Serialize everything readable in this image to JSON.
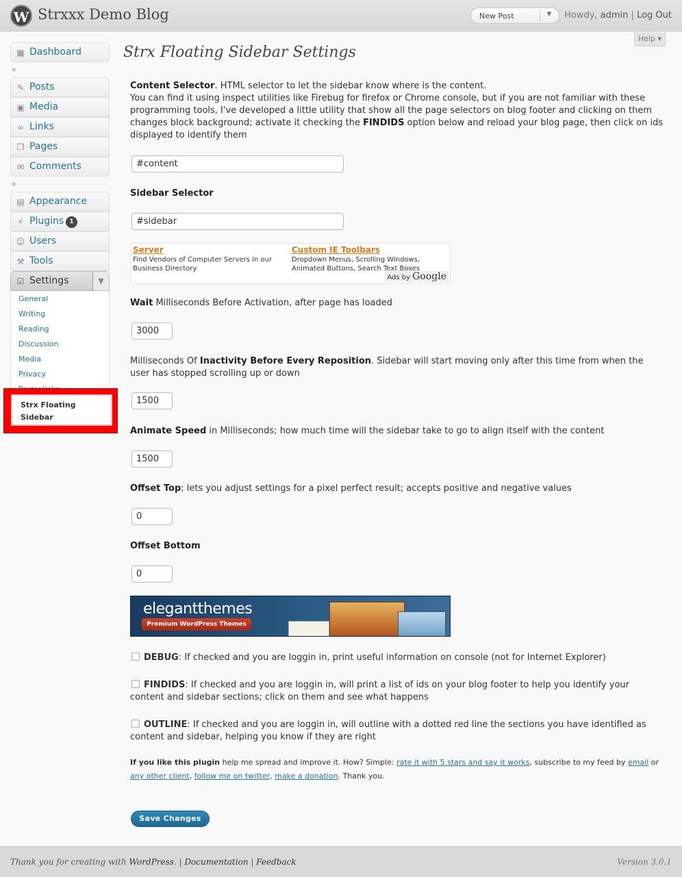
{
  "header": {
    "logo": "W",
    "site_title": "Strxxx Demo Blog",
    "favorite_action": "New Post",
    "howdy": "Howdy,",
    "user": "admin",
    "separator": "|",
    "logout": "Log Out",
    "help": "Help ▾"
  },
  "menu": {
    "dashboard": "Dashboard",
    "posts": "Posts",
    "media": "Media",
    "links": "Links",
    "pages": "Pages",
    "comments": "Comments",
    "appearance": "Appearance",
    "plugins": "Plugins",
    "plugins_badge": "1",
    "users": "Users",
    "tools": "Tools",
    "settings": "Settings",
    "settings_sub": [
      "General",
      "Writing",
      "Reading",
      "Discussion",
      "Media",
      "Privacy",
      "Permalinks"
    ],
    "current_sub_line1": "Strx Floating",
    "current_sub_line2": "Sidebar"
  },
  "page": {
    "title": "Strx Floating Sidebar Settings",
    "content_selector_label": "Content Selector",
    "content_selector_desc_1": ". HTML selector to let the sidebar know where is the content.",
    "content_selector_desc_2": "You can find it using inspect utilities like Firebug for firefox or Chrome console, but if you are not familiar with these programming tools, I've developed a little utility that show all the page selectors on blog footer and clicking on them changes block background; activate it checking the ",
    "findids_word": "FINDIDS",
    "content_selector_desc_3": " option below and reload your blog page, then click on ids displayed to identify them",
    "content_selector_value": "#content",
    "sidebar_selector_label": "Sidebar Selector",
    "sidebar_selector_value": "#sidebar",
    "wait_label": "Wait",
    "wait_desc": " Milliseconds Before Activation, after page has loaded",
    "wait_value": "3000",
    "inactivity_pre": "Milliseconds Of ",
    "inactivity_label": "Inactivity Before Every Reposition",
    "inactivity_desc": ". Sidebar will start moving only after this time from when the user has stopped scrolling up or down",
    "inactivity_value": "1500",
    "animate_label": "Animate Speed",
    "animate_desc": " in Milliseconds; how much time will the sidebar take to go to align itself with the content",
    "animate_value": "1500",
    "offset_top_label": "Offset Top",
    "offset_top_desc": "; lets you adjust settings for a pixel perfect result; accepts positive and negative values",
    "offset_top_value": "0",
    "offset_bottom_label": "Offset Bottom",
    "offset_bottom_value": "0",
    "debug_label": "DEBUG",
    "debug_desc": ": If checked and you are loggin in, print useful information on console (not for Internet Explorer)",
    "findids_label": "FINDIDS",
    "findids_desc": ": If checked and you are loggin in, will print a list of ids on your blog footer to help you identify your content and sidebar sections; click on them and see what happens",
    "outline_label": "OUTLINE",
    "outline_desc": ": If checked and you are loggin in, will outline with a dotted red line the sections you have identified as content and sidebar, helping you know if they are right",
    "save_button": "Save Changes"
  },
  "ads": {
    "ad1_title": "Server",
    "ad1_desc": "Find Vendors of Computer Servers In our Business Directory",
    "ad2_title": "Custom IE Toolbars",
    "ad2_desc": "Dropdown Menus, Scrolling Windows, Animated Buttons, Search Text Boxes",
    "ads_by": "Ads by",
    "google": "Google"
  },
  "banner": {
    "brand": "elegantthemes",
    "tagline": "Premium WordPress Themes"
  },
  "promo": {
    "lead": "If you like this plugin",
    "text1": " help me spread and improve it. How? Simple: ",
    "link_rate": "rate it with 5 stars and say it works",
    "text2": ", subscribe to my feed by ",
    "link_email": "email",
    "text3": " or ",
    "link_other": "any other client",
    "text4": ", ",
    "link_twitter": "follow me on twitter",
    "text5": ", ",
    "link_donation": "make a donation",
    "text6": ". Thank you."
  },
  "footer": {
    "thanks": "Thank you for creating with ",
    "wordpress": "WordPress",
    "dot": ".",
    "sep": " | ",
    "documentation": "Documentation",
    "feedback": "Feedback",
    "version": "Version 3.0.1"
  }
}
